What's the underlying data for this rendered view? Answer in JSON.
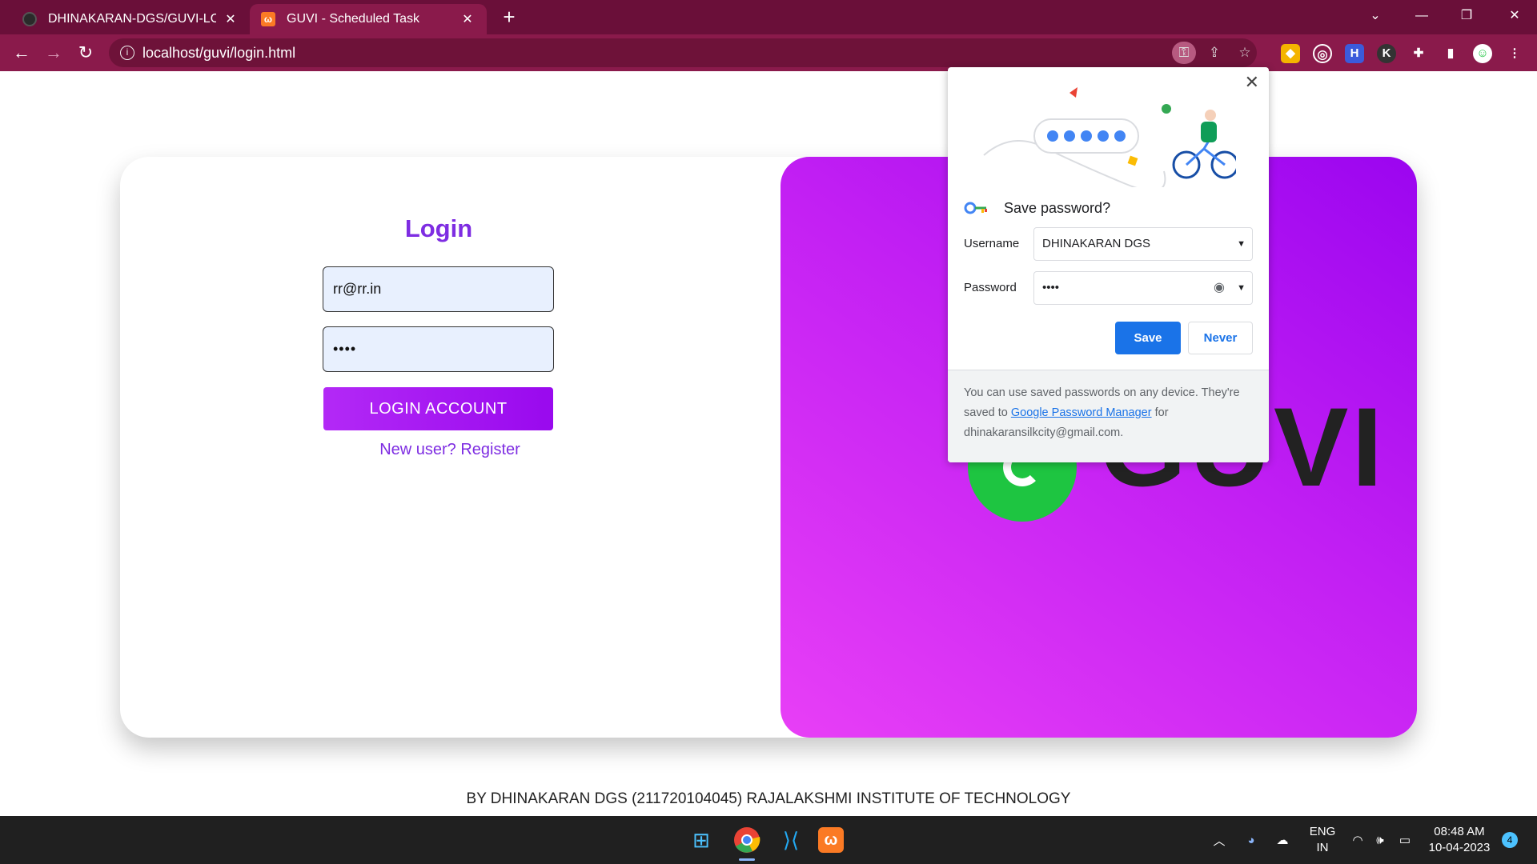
{
  "browser": {
    "tabs": [
      {
        "title": "DHINAKARAN-DGS/GUVI-LOGIN",
        "close": "✕"
      },
      {
        "title": "GUVI - Scheduled Task",
        "close": "✕"
      }
    ],
    "new_tab": "+",
    "url": "localhost/guvi/login.html"
  },
  "page": {
    "login_title": "Login",
    "email_value": "rr@rr.in",
    "password_value": "••••",
    "login_button": "LOGIN ACCOUNT",
    "register_link": "New user? Register",
    "footer": "BY DHINAKARAN DGS (211720104045) RAJALAKSHMI INSTITUTE OF TECHNOLOGY",
    "logo_text": "GUVI"
  },
  "password_bubble": {
    "title": "Save password?",
    "username_label": "Username",
    "username_value": "DHINAKARAN DGS",
    "password_label": "Password",
    "password_value": "••••",
    "save_label": "Save",
    "never_label": "Never",
    "footer_prefix": "You can use saved passwords on any device. They're saved to",
    "footer_link": "Google Password Manager",
    "footer_suffix": "for dhinakaransilkcity@gmail.com."
  },
  "taskbar": {
    "language_top": "ENG",
    "language_bottom": "IN",
    "time": "08:48 AM",
    "date": "10-04-2023",
    "notification_count": "4"
  },
  "colors": {
    "tabbar": "#6a0f39",
    "toolbar": "#8a1a4b",
    "accent_purple": "#7e2de2",
    "panel_gradient_start": "#9b05f0",
    "panel_gradient_end": "#e83ff6",
    "save_blue": "#1a73e8"
  }
}
